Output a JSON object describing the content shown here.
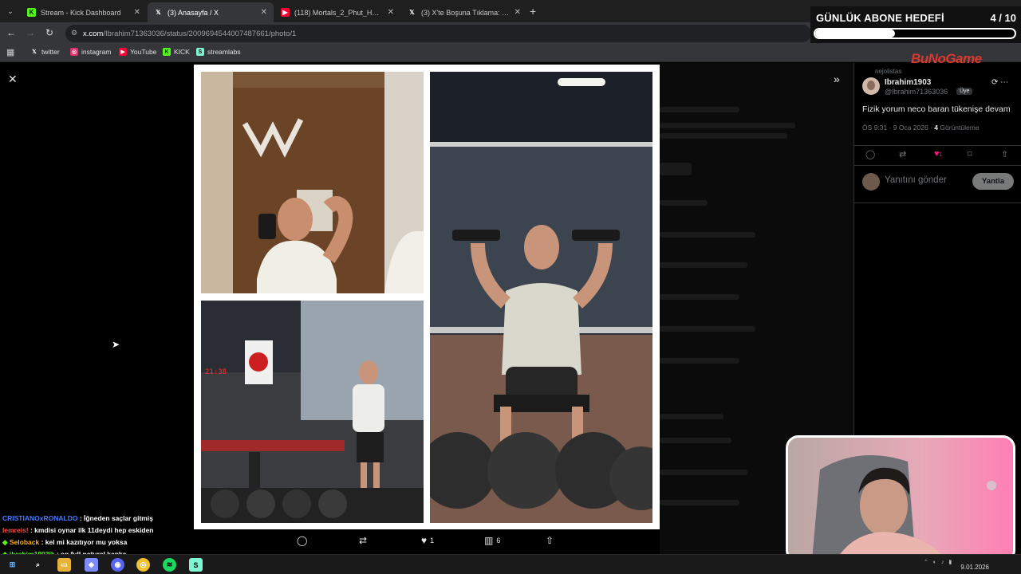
{
  "browser": {
    "tabs": [
      {
        "label": "Stream - Kick Dashboard",
        "favicon": "kick-icon",
        "color": "#53fc18"
      },
      {
        "label": "(3) Anasayfa / X",
        "favicon": "x-icon",
        "color": "#ffffff",
        "active": true
      },
      {
        "label": "(118) Mortals_2_Phut_Hon_Funk",
        "favicon": "youtube-icon",
        "color": "#ff0033"
      },
      {
        "label": "(3) X'te Boşuna Tıklama: \"Volka",
        "favicon": "x-icon",
        "color": "#ffffff"
      }
    ],
    "url_host": "x.com",
    "url_path": "/Ibrahim71363036/status/2009694544007487661/photo/1",
    "bookmarks": [
      {
        "label": "twitter",
        "icon": "x-icon"
      },
      {
        "label": "instagram",
        "icon": "instagram-icon"
      },
      {
        "label": "YouTube",
        "icon": "youtube-icon"
      },
      {
        "label": "KICK",
        "icon": "kick-icon"
      },
      {
        "label": "streamlabs",
        "icon": "streamlabs-icon"
      }
    ]
  },
  "overlay": {
    "goal_title": "GÜNLÜK ABONE HEDEFİ",
    "goal_count": "4 / 10",
    "goal_progress": 0.4,
    "brand": "BuNoGame"
  },
  "photo_actions": {
    "likes": "1",
    "views": "6"
  },
  "tweet": {
    "reposted_by": "nejolistas",
    "name": "Ibrahim1903",
    "handle": "@Ibrahim71363036",
    "badge": "Üye",
    "text": "Fizik yorum neco baran tükenişe devam",
    "time": "ÖS 9:31 · 9 Oca 2026 · ",
    "views_count": "4",
    "views_label": "Görüntüleme",
    "likes": "1",
    "reply_placeholder": "Yanıtını gönder",
    "reply_button": "Yantla"
  },
  "chat": [
    {
      "user": "CRISTIANOxRONALDO",
      "color": "#4a7bff",
      "msg": " : İğneden saçlar gitmiş"
    },
    {
      "user": "lemreis!",
      "color": "#ff4d4d",
      "msg": " : kmdisi oynar ilk 11deydi hep eskiden"
    },
    {
      "user": "Seloback",
      "color": "#ffb020",
      "msg": " : kel mi kazıtıyor mu yoksa"
    },
    {
      "user": "ibrahim1903jk",
      "color": "#53fc18",
      "msg": " : aq full naturel kanka"
    }
  ],
  "taskbar": {
    "date": "9.01.2026"
  }
}
